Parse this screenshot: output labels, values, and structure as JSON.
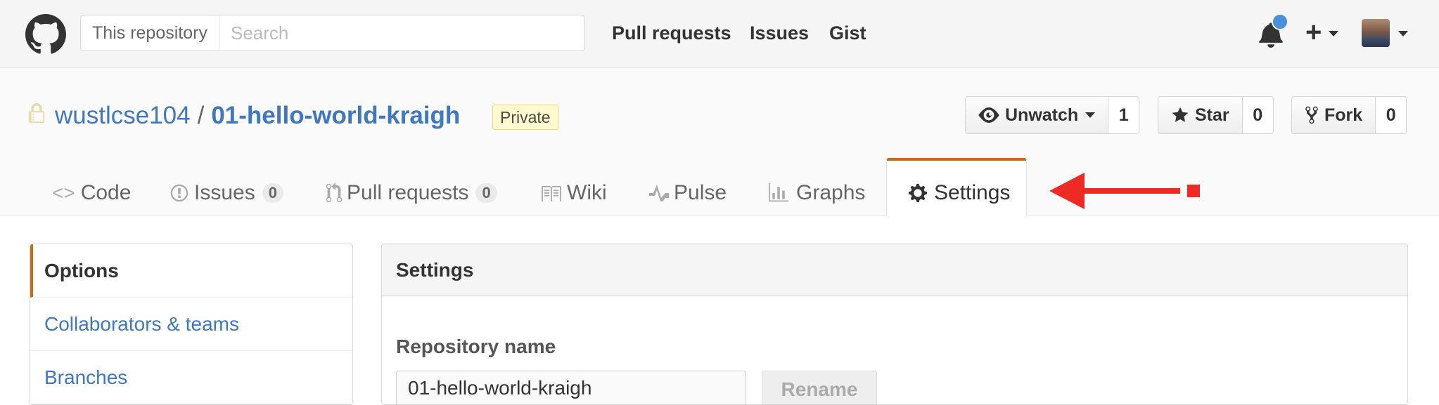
{
  "header": {
    "search_scope": "This repository",
    "search_placeholder": "Search",
    "nav": [
      "Pull requests",
      "Issues",
      "Gist"
    ]
  },
  "repo": {
    "owner": "wustlcse104",
    "separator": "/",
    "name": "01-hello-world-kraigh",
    "visibility": "Private",
    "actions": {
      "watch": {
        "label": "Unwatch",
        "count": "1"
      },
      "star": {
        "label": "Star",
        "count": "0"
      },
      "fork": {
        "label": "Fork",
        "count": "0"
      }
    }
  },
  "tabs": [
    {
      "label": "Code",
      "icon": "code-icon"
    },
    {
      "label": "Issues",
      "count": "0",
      "icon": "issue-icon"
    },
    {
      "label": "Pull requests",
      "count": "0",
      "icon": "pull-request-icon"
    },
    {
      "label": "Wiki",
      "icon": "book-icon"
    },
    {
      "label": "Pulse",
      "icon": "pulse-icon"
    },
    {
      "label": "Graphs",
      "icon": "graph-icon"
    },
    {
      "label": "Settings",
      "icon": "gear-icon",
      "selected": true
    }
  ],
  "sidebar": {
    "items": [
      {
        "label": "Options",
        "selected": true
      },
      {
        "label": "Collaborators & teams"
      },
      {
        "label": "Branches"
      }
    ]
  },
  "settings": {
    "title": "Settings",
    "repo_name_label": "Repository name",
    "repo_name_value": "01-hello-world-kraigh",
    "rename_label": "Rename"
  },
  "colors": {
    "link": "#4078c0",
    "selected_accent": "#d26911",
    "annotation_arrow": "#ee2a24",
    "private_badge_bg": "#fff9d0"
  }
}
